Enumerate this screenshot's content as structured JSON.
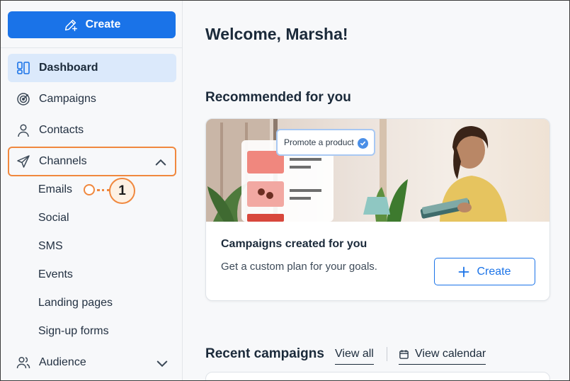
{
  "sidebar": {
    "create_label": "Create",
    "nav": [
      {
        "label": "Dashboard",
        "icon": "dashboard-icon",
        "active": true
      },
      {
        "label": "Campaigns",
        "icon": "target-icon"
      },
      {
        "label": "Contacts",
        "icon": "person-icon"
      },
      {
        "label": "Channels",
        "icon": "send-icon",
        "expanded": true
      },
      {
        "label": "Audience",
        "icon": "people-icon"
      }
    ],
    "channels_sub": [
      "Emails",
      "Social",
      "SMS",
      "Events",
      "Landing pages",
      "Sign-up forms"
    ],
    "callout_number": "1"
  },
  "main": {
    "welcome": "Welcome, Marsha!",
    "recommended_title": "Recommended for you",
    "card": {
      "chip_label": "Promote a product",
      "title": "Campaigns created for you",
      "description": "Get a custom plan for your goals.",
      "button_label": "Create"
    },
    "recent": {
      "title": "Recent campaigns",
      "view_all": "View all",
      "view_calendar": "View calendar"
    }
  },
  "colors": {
    "accent": "#1a73e8",
    "active_bg": "#dbe9fb",
    "highlight": "#f0883e"
  }
}
